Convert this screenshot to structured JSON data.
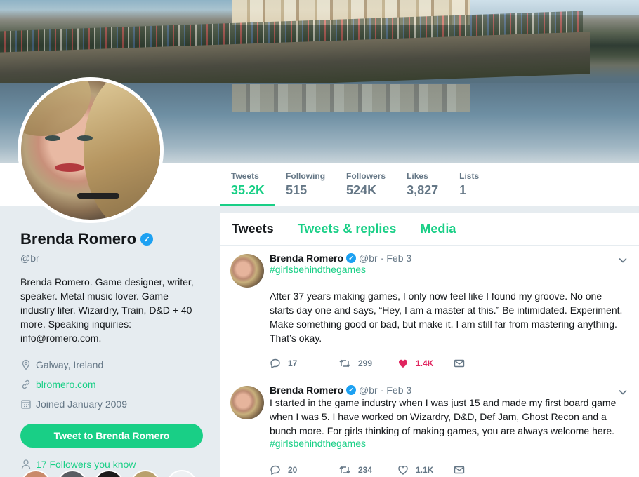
{
  "stats": [
    {
      "label": "Tweets",
      "value": "35.2K"
    },
    {
      "label": "Following",
      "value": "515"
    },
    {
      "label": "Followers",
      "value": "524K"
    },
    {
      "label": "Likes",
      "value": "3,827"
    },
    {
      "label": "Lists",
      "value": "1"
    }
  ],
  "profile": {
    "name": "Brenda Romero",
    "handle": "@br",
    "bio": "Brenda Romero. Game designer, writer, speaker. Metal music lover. Game industry lifer. Wizardry, Train, D&D + 40 more. Speaking inquiries: info@romero.com.",
    "location": "Galway, Ireland",
    "website": "blromero.com",
    "joined": "Joined January 2009",
    "tweet_to_label": "Tweet to Brenda Romero",
    "followers_you_know": "17 Followers you know"
  },
  "timeline": {
    "tabs": [
      "Tweets",
      "Tweets & replies",
      "Media"
    ],
    "tweets": [
      {
        "name": "Brenda Romero",
        "handle": "@br",
        "date": "Feb 3",
        "hashtag_top": "#girlsbehindthegames",
        "text": "After 37 years making games, I only now feel like I found my groove. No one starts day one and says, “Hey, I am a master at this.” Be intimidated. Experiment. Make something good or bad, but make it. I am still far from mastering anything. That’s okay.",
        "hashtag_bottom": "",
        "replies": "17",
        "retweets": "299",
        "likes": "1.4K"
      },
      {
        "name": "Brenda Romero",
        "handle": "@br",
        "date": "Feb 3",
        "hashtag_top": "",
        "text": "I started in the game industry when I was just 15 and made my first board game when I was 5. I have worked on Wizardry, D&D, Def Jam, Ghost Recon and a bunch more. For girls thinking of making games, you are always welcome here.",
        "hashtag_bottom": "#girlsbehindthegames",
        "replies": "20",
        "retweets": "234",
        "likes": "1.1K"
      }
    ]
  },
  "colors": {
    "accent": "#19cf86",
    "like": "#e0245e",
    "verified": "#1da1f2"
  }
}
